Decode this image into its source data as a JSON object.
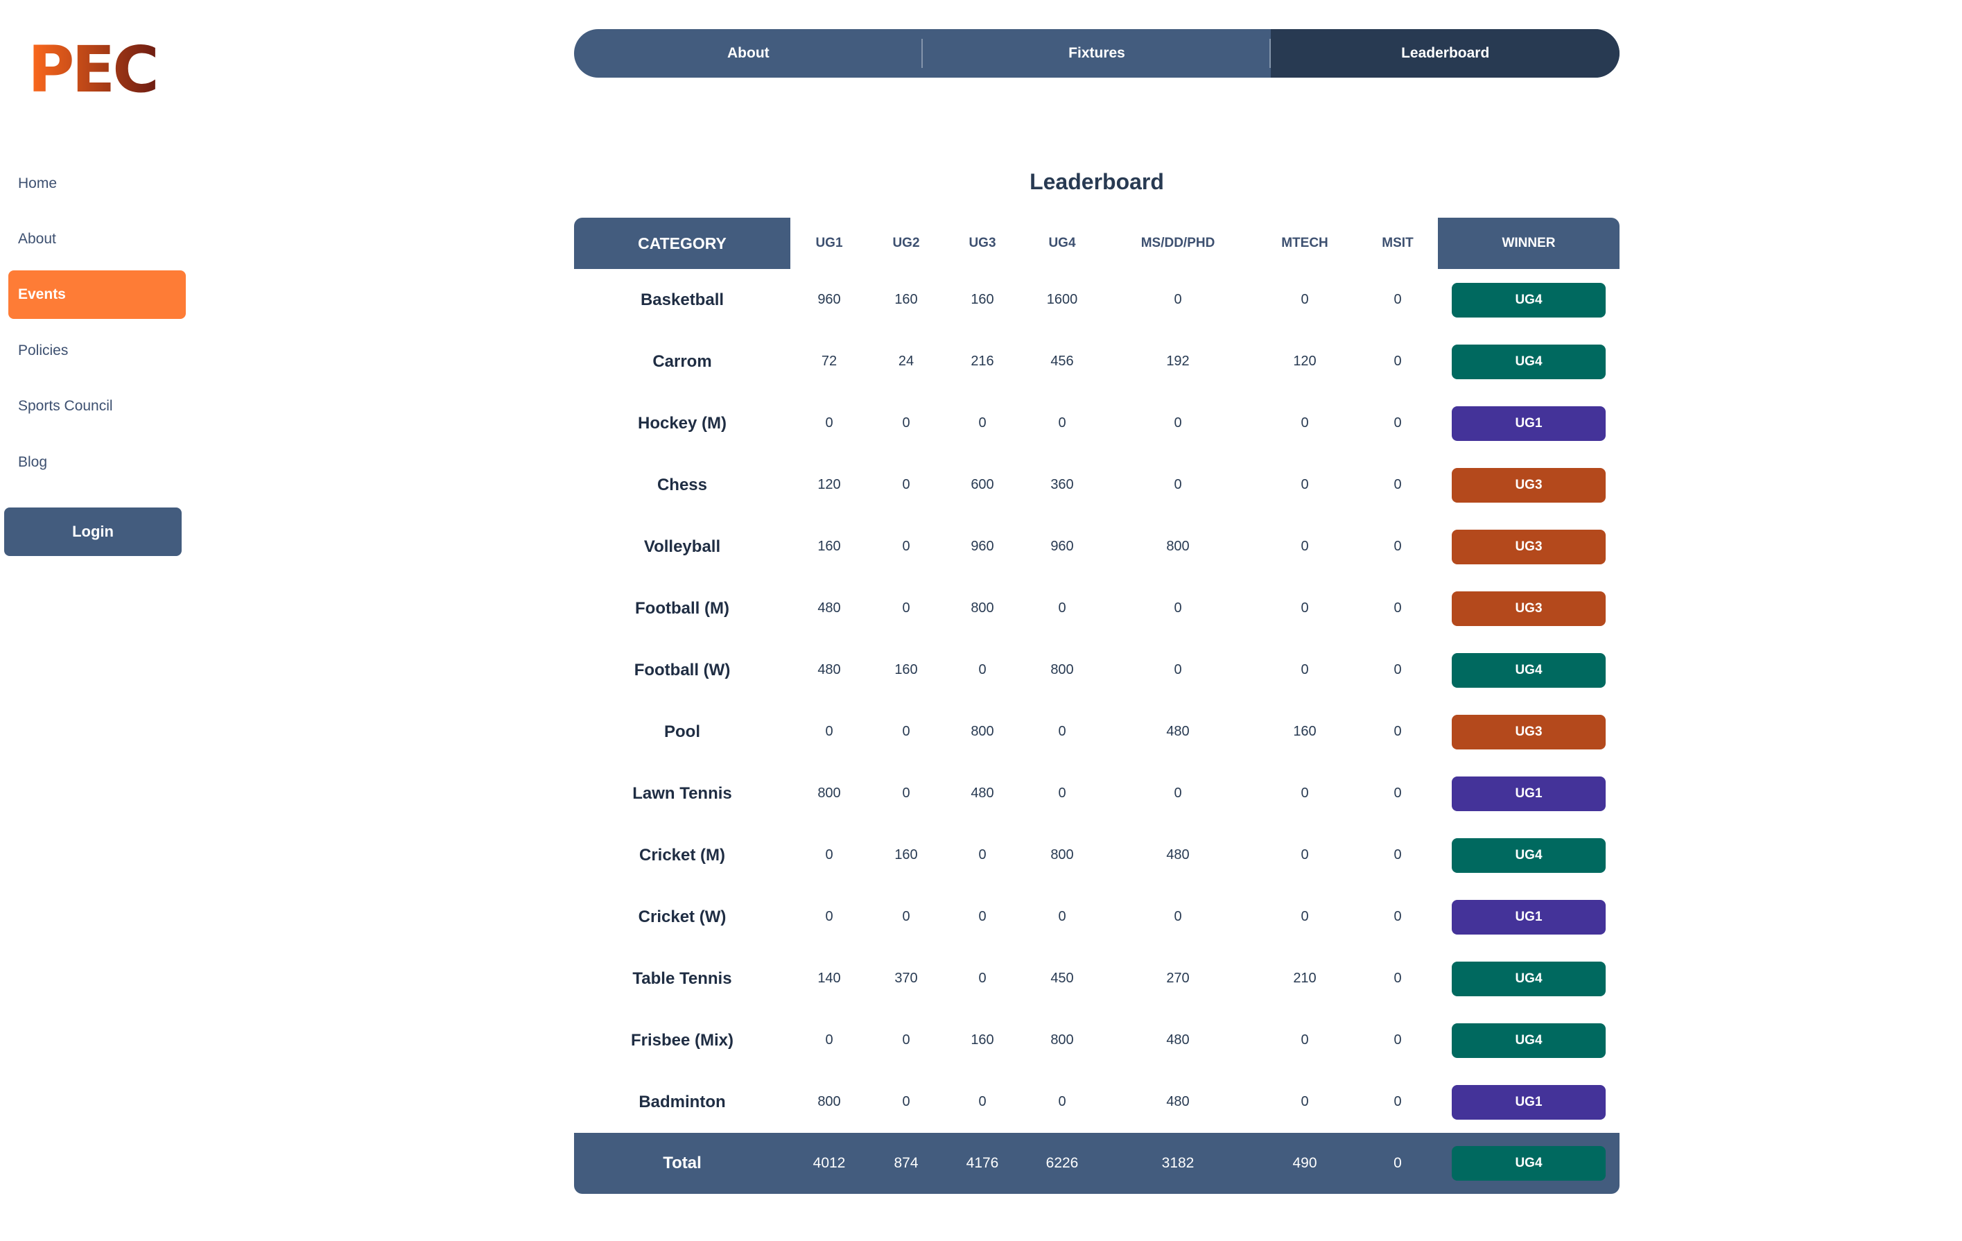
{
  "logo": {
    "text": "PEC",
    "color_start": "#fe6a1d",
    "color_end": "#6e1d12"
  },
  "sidebar": {
    "items": [
      {
        "label": "Home",
        "active": false
      },
      {
        "label": "About",
        "active": false
      },
      {
        "label": "Events",
        "active": true
      },
      {
        "label": "Policies",
        "active": false
      },
      {
        "label": "Sports Council",
        "active": false
      },
      {
        "label": "Blog",
        "active": false
      }
    ],
    "login_label": "Login"
  },
  "tabs": [
    {
      "label": "About",
      "active": false
    },
    {
      "label": "Fixtures",
      "active": false
    },
    {
      "label": "Leaderboard",
      "active": true
    }
  ],
  "leaderboard": {
    "title": "Leaderboard",
    "columns": [
      "CATEGORY",
      "UG1",
      "UG2",
      "UG3",
      "UG4",
      "MS/DD/PHD",
      "MTECH",
      "MSIT",
      "WINNER"
    ],
    "rows": [
      {
        "category": "Basketball",
        "scores": [
          "960",
          "160",
          "160",
          "1600",
          "0",
          "0",
          "0"
        ],
        "winner": "UG4"
      },
      {
        "category": "Carrom",
        "scores": [
          "72",
          "24",
          "216",
          "456",
          "192",
          "120",
          "0"
        ],
        "winner": "UG4"
      },
      {
        "category": "Hockey (M)",
        "scores": [
          "0",
          "0",
          "0",
          "0",
          "0",
          "0",
          "0"
        ],
        "winner": "UG1"
      },
      {
        "category": "Chess",
        "scores": [
          "120",
          "0",
          "600",
          "360",
          "0",
          "0",
          "0"
        ],
        "winner": "UG3"
      },
      {
        "category": "Volleyball",
        "scores": [
          "160",
          "0",
          "960",
          "960",
          "800",
          "0",
          "0"
        ],
        "winner": "UG3"
      },
      {
        "category": "Football (M)",
        "scores": [
          "480",
          "0",
          "800",
          "0",
          "0",
          "0",
          "0"
        ],
        "winner": "UG3"
      },
      {
        "category": "Football (W)",
        "scores": [
          "480",
          "160",
          "0",
          "800",
          "0",
          "0",
          "0"
        ],
        "winner": "UG4"
      },
      {
        "category": "Pool",
        "scores": [
          "0",
          "0",
          "800",
          "0",
          "480",
          "160",
          "0"
        ],
        "winner": "UG3"
      },
      {
        "category": "Lawn Tennis",
        "scores": [
          "800",
          "0",
          "480",
          "0",
          "0",
          "0",
          "0"
        ],
        "winner": "UG1"
      },
      {
        "category": "Cricket (M)",
        "scores": [
          "0",
          "160",
          "0",
          "800",
          "480",
          "0",
          "0"
        ],
        "winner": "UG4"
      },
      {
        "category": "Cricket (W)",
        "scores": [
          "0",
          "0",
          "0",
          "0",
          "0",
          "0",
          "0"
        ],
        "winner": "UG1"
      },
      {
        "category": "Table Tennis",
        "scores": [
          "140",
          "370",
          "0",
          "450",
          "270",
          "210",
          "0"
        ],
        "winner": "UG4"
      },
      {
        "category": "Frisbee (Mix)",
        "scores": [
          "0",
          "0",
          "160",
          "800",
          "480",
          "0",
          "0"
        ],
        "winner": "UG4"
      },
      {
        "category": "Badminton",
        "scores": [
          "800",
          "0",
          "0",
          "0",
          "480",
          "0",
          "0"
        ],
        "winner": "UG1"
      }
    ],
    "total": {
      "label": "Total",
      "scores": [
        "4012",
        "874",
        "4176",
        "6226",
        "3182",
        "490",
        "0"
      ],
      "winner": "UG4"
    },
    "winner_colors": {
      "UG1": "#443399",
      "UG3": "#b4491c",
      "UG4": "#00695f"
    }
  }
}
